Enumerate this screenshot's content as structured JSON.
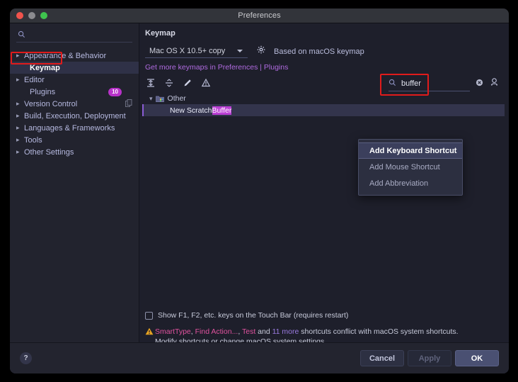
{
  "window": {
    "title": "Preferences",
    "traffic_lights": [
      "close-button",
      "minimize-button",
      "zoom-button"
    ]
  },
  "sidebar": {
    "search": {
      "value": "",
      "placeholder": ""
    },
    "items": [
      {
        "label": "Appearance & Behavior",
        "expandable": true,
        "selected": false
      },
      {
        "label": "Keymap",
        "expandable": false,
        "selected": true
      },
      {
        "label": "Editor",
        "expandable": true,
        "selected": false
      },
      {
        "label": "Plugins",
        "expandable": false,
        "selected": false,
        "badge": "10"
      },
      {
        "label": "Version Control",
        "expandable": true,
        "selected": false,
        "icon": "copy-icon"
      },
      {
        "label": "Build, Execution, Deployment",
        "expandable": true,
        "selected": false
      },
      {
        "label": "Languages & Frameworks",
        "expandable": true,
        "selected": false
      },
      {
        "label": "Tools",
        "expandable": true,
        "selected": false
      },
      {
        "label": "Other Settings",
        "expandable": true,
        "selected": false
      }
    ]
  },
  "panel": {
    "title": "Keymap",
    "keymap_select": {
      "value": "Mac OS X 10.5+ copy"
    },
    "gear_icon": "gear-icon",
    "based_on": "Based on macOS keymap",
    "get_more_prefix": "Get more keymaps in Preferences",
    "get_more_separator": " | ",
    "get_more_suffix": "Plugins",
    "toolbar": [
      {
        "name": "expand-all-icon",
        "title": "Expand All"
      },
      {
        "name": "collapse-all-icon",
        "title": "Collapse All"
      },
      {
        "name": "edit-shortcut-icon",
        "title": "Edit Shortcut"
      },
      {
        "name": "conflicts-icon",
        "title": "Conflicts"
      }
    ],
    "find": {
      "value": "buffer",
      "placeholder": "",
      "search_icon": "search-icon",
      "clear_icon": "clear-icon",
      "filter_icon": "filter-by-shortcut-icon"
    },
    "tree": [
      {
        "type": "group",
        "label": "Other",
        "expanded": true,
        "icon": "folder-icon"
      },
      {
        "type": "action",
        "label_prefix": "New Scratch ",
        "label_match": "Buffer",
        "selected": true
      }
    ]
  },
  "context_menu": {
    "items": [
      {
        "label": "Add Keyboard Shortcut",
        "active": true
      },
      {
        "label": "Add Mouse Shortcut",
        "active": false
      },
      {
        "label": "Add Abbreviation",
        "active": false
      }
    ]
  },
  "bottom": {
    "touchbar_checkbox": {
      "label": "Show F1, F2, etc. keys on the Touch Bar (requires restart)",
      "checked": false
    },
    "warning": {
      "icon": "warning-icon",
      "link1": "SmartType",
      "sep1": ", ",
      "link2": "Find Action...",
      "sep2": ", ",
      "link3": "Test",
      "sep3": " and ",
      "link4": "11 more",
      "tail": " shortcuts conflict with macOS system shortcuts.",
      "line2": "Modify shortcuts or change macOS system settings."
    }
  },
  "footer": {
    "help_label": "?",
    "cancel_label": "Cancel",
    "apply_label": "Apply",
    "ok_label": "OK"
  },
  "annotations": {
    "highlight_color": "#e01b1b",
    "boxes": [
      "sidebar-keymap-highlight",
      "search-field-highlight"
    ]
  },
  "colors": {
    "accent_purple": "#b06be0",
    "badge_magenta": "#b832c9",
    "match_highlight": "#bb3fd4",
    "link_pink": "#e0529e",
    "ok_button": "#4a5072"
  }
}
